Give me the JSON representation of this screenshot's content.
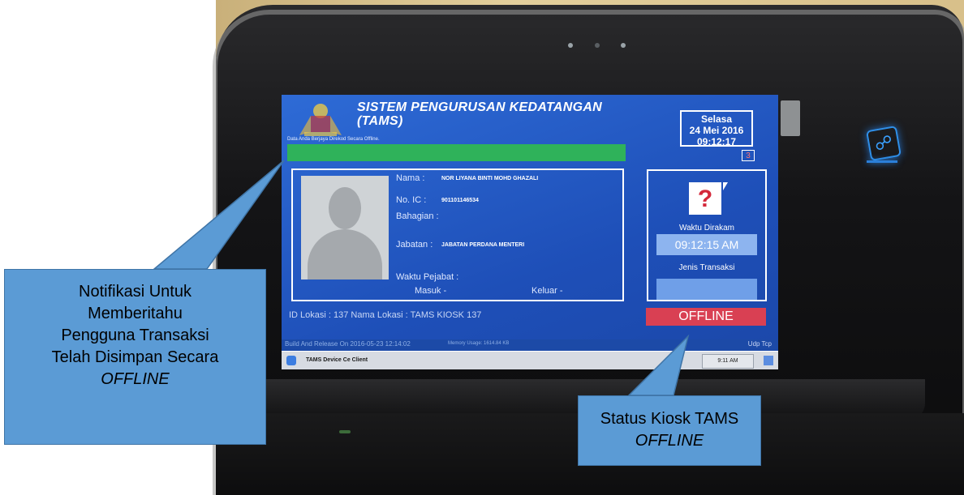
{
  "app": {
    "title_line1": "SISTEM PENGURUSAN KEDATANGAN",
    "title_line2": "(TAMS)",
    "day": "Selasa",
    "date": "24 Mei 2016",
    "time": "09:12:17",
    "counter": "3",
    "notification": "Data Anda Berjaya Direkod Secara Offline."
  },
  "profile": {
    "nama_label": "Nama :",
    "nama_value": "NOR LIYANA BINTI MOHD GHAZALI",
    "ic_label": "No. IC :",
    "ic_value": "901101146534",
    "bahagian_label": "Bahagian :",
    "jabatan_label": "Jabatan :",
    "jabatan_value": "JABATAN PERDANA MENTERI",
    "waktu_pejabat_label": "Waktu Pejabat :",
    "masuk_label": "Masuk -",
    "keluar_label": "Keluar -"
  },
  "transaction": {
    "waktu_dirakam_label": "Waktu Dirakam",
    "waktu_dirakam_value": "09:12:15 AM",
    "jenis_transaksi_label": "Jenis Transaksi",
    "status": "OFFLINE"
  },
  "location": "ID Lokasi : 137  Nama Lokasi : TAMS KIOSK 137",
  "statusbar": {
    "build": "Build And Release On 2016-05-23 12:14:02",
    "memory": "Memory Usage: 1614.84 KB",
    "protocols": "Udp    Tcp"
  },
  "taskbar": {
    "app_button": "TAMS Device Ce Client",
    "clock": "9:11 AM"
  },
  "callouts": {
    "left": {
      "line1": "Notifikasi Untuk",
      "line2": "Memberitahu",
      "line3": "Pengguna Transaksi",
      "line4": "Telah Disimpan Secara",
      "line5": "OFFLINE"
    },
    "right": {
      "line1": "Status Kiosk TAMS",
      "line2": "OFFLINE"
    }
  },
  "colors": {
    "screen_blue": "#1e4fb8",
    "notification_green": "#2fb25a",
    "offline_red": "#d94053",
    "callout_blue": "#5b9bd5"
  }
}
